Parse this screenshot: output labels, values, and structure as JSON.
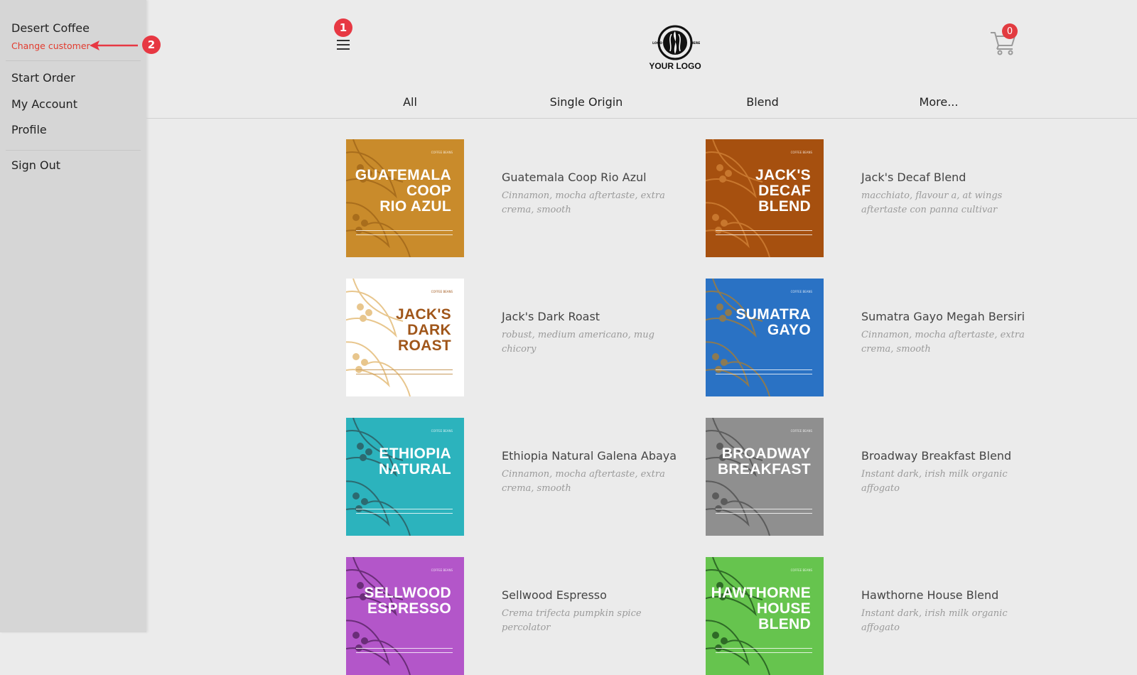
{
  "sidebar": {
    "customer": "Desert Coffee",
    "change_customer": "Change customer",
    "items": [
      {
        "label": "Start Order"
      },
      {
        "label": "My Account"
      },
      {
        "label": "Profile"
      },
      {
        "label": "Sign Out"
      }
    ]
  },
  "annotations": [
    "1",
    "2"
  ],
  "header": {
    "logo_text": "YOUR LOGO",
    "logo_small_left": "LOGO",
    "logo_small_right": "HERE",
    "cart_count": "0"
  },
  "tabs": [
    {
      "label": "All"
    },
    {
      "label": "Single Origin"
    },
    {
      "label": "Blend"
    },
    {
      "label": "More..."
    }
  ],
  "products": [
    {
      "title": "Guatemala Coop Rio Azul",
      "desc": "Cinnamon, mocha aftertaste, extra crema, smooth",
      "label_line1": "GUATEMALA",
      "label_line2": "COOP",
      "label_line3": "RIO AZUL",
      "color": "#c98b2b",
      "leaf_color": "#a86d1c"
    },
    {
      "title": "Jack's Decaf Blend",
      "desc": "macchiato, flavour a, at wings aftertaste con panna cultivar",
      "label_line1": "JACK'S",
      "label_line2": "DECAF",
      "label_line3": "BLEND",
      "color": "#a6500f",
      "leaf_color": "#c8772e"
    },
    {
      "title": "Jack's Dark Roast",
      "desc": "robust, medium americano, mug chicory",
      "label_line1": "JACK'S",
      "label_line2": "DARK",
      "label_line3": "ROAST",
      "color": "#ffffff",
      "leaf_color": "#e8c68d"
    },
    {
      "title": "Sumatra Gayo Megah Bersiri",
      "desc": "Cinnamon, mocha aftertaste, extra crema, smooth",
      "label_line1": "SUMATRA",
      "label_line2": "GAYO",
      "label_line3": "",
      "color": "#2a72c4",
      "leaf_color": "#8c7a52"
    },
    {
      "title": "Ethiopia Natural Galena Abaya",
      "desc": "Cinnamon, mocha aftertaste, extra crema, smooth",
      "label_line1": "ETHIOPIA",
      "label_line2": "NATURAL",
      "label_line3": "",
      "color": "#2cb3bd",
      "leaf_color": "#2c6a70"
    },
    {
      "title": "Broadway Breakfast Blend",
      "desc": "Instant dark, irish milk organic affogato",
      "label_line1": "BROADWAY",
      "label_line2": "BREAKFAST",
      "label_line3": "",
      "color": "#8f8f8f",
      "leaf_color": "#5c5c5c"
    },
    {
      "title": "Sellwood Espresso",
      "desc": "Crema trifecta pumpkin spice percolator",
      "label_line1": "SELLWOOD",
      "label_line2": "ESPRESSO",
      "label_line3": "",
      "color": "#b356c9",
      "leaf_color": "#6a2d78"
    },
    {
      "title": "Hawthorne House Blend",
      "desc": "Instant dark, irish milk organic affogato",
      "label_line1": "HAWTHORNE",
      "label_line2": "HOUSE BLEND",
      "label_line3": "",
      "color": "#66c44e",
      "leaf_color": "#2e6a26"
    }
  ]
}
